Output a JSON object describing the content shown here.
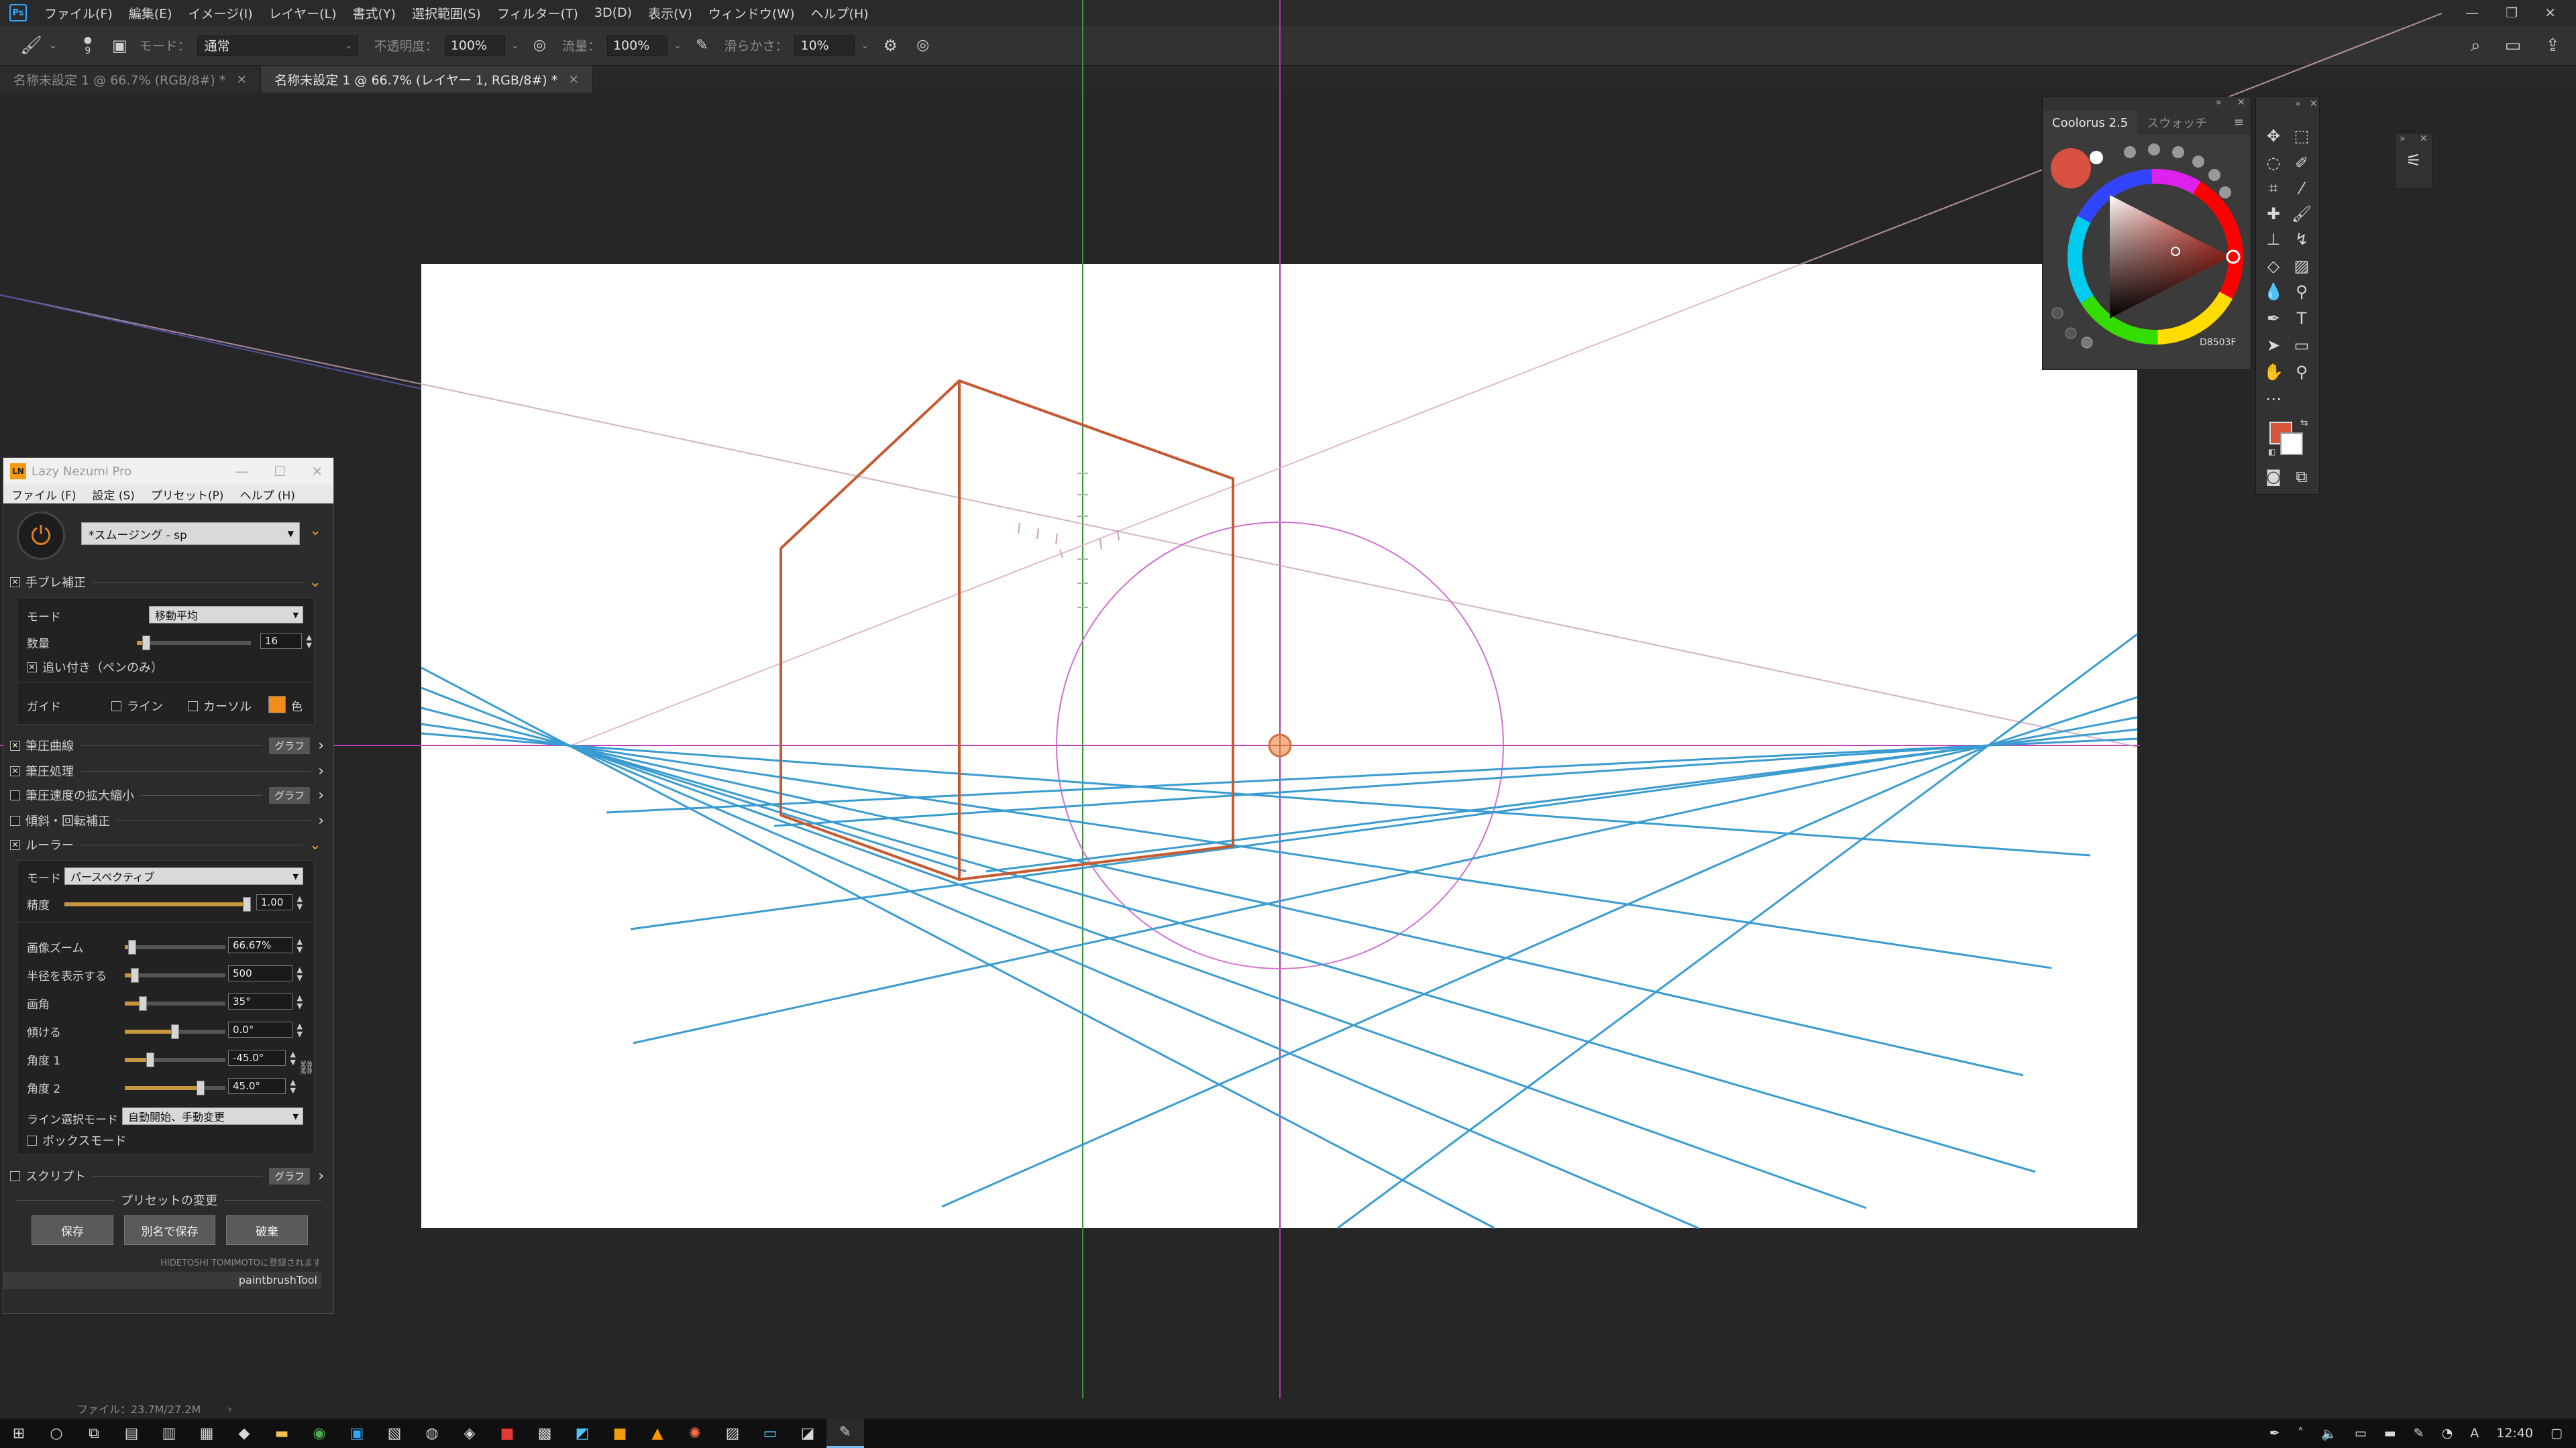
{
  "menubar": {
    "app_icon": "Ps",
    "items": [
      "ファイル(F)",
      "編集(E)",
      "イメージ(I)",
      "レイヤー(L)",
      "書式(Y)",
      "選択範囲(S)",
      "フィルター(T)",
      "3D(D)",
      "表示(V)",
      "ウィンドウ(W)",
      "ヘルプ(H)"
    ]
  },
  "options_bar": {
    "mode_label": "モード：",
    "mode_value": "通常",
    "opacity_label": "不透明度：",
    "opacity_value": "100%",
    "flow_label": "流量：",
    "flow_value": "100%",
    "smoothing_label": "滑らかさ：",
    "smoothing_value": "10%",
    "brush_size": "9"
  },
  "tabs": [
    {
      "label": "名称未設定 1 @ 66.7% (RGB/8#) *",
      "active": false
    },
    {
      "label": "名称未設定 1 @ 66.7% (レイヤー 1, RGB/8#) *",
      "active": true
    }
  ],
  "status": {
    "text": "ファイル：23.7M/27.2M"
  },
  "taskbar": {
    "time": "12:40"
  },
  "lazy_nezumi": {
    "title": "Lazy Nezumi Pro",
    "icon_text": "LN",
    "menu": [
      "ファイル (F)",
      "設定 (S)",
      "プリセット(P)",
      "ヘルプ (H)"
    ],
    "preset": "*スムージング - sp",
    "stabilizer": {
      "label": "手ブレ補正",
      "mode_label": "モード",
      "mode_value": "移動平均",
      "amount_label": "数量",
      "amount_value": "16",
      "amount_fraction": 0.08,
      "pen_only_label": "追い付き（ペンのみ）",
      "guide_label": "ガイド",
      "line_label": "ライン",
      "cursor_label": "カーソル",
      "color_label": "色",
      "guide_color": "#f28c1c"
    },
    "sections": {
      "pressure_curve": "筆圧曲線",
      "pressure_process": "筆圧処理",
      "pressure_scale": "筆圧速度の拡大縮小",
      "tilt": "傾斜・回転補正",
      "ruler": "ルーラー",
      "graph": "グラフ"
    },
    "ruler": {
      "mode_label": "モード",
      "mode_value": "パースペクティブ",
      "precision_label": "精度",
      "precision_value": "1.00",
      "precision_fraction": 1.0,
      "zoom_label": "画像ズーム",
      "zoom_value": "66.67%",
      "zoom_fraction": 0.07,
      "radius_label": "半径を表示する",
      "radius_value": "500",
      "radius_fraction": 0.1,
      "fov_label": "画角",
      "fov_value": "35°",
      "fov_fraction": 0.18,
      "tilt_label": "傾ける",
      "tilt_value": "0.0°",
      "tilt_fraction": 0.5,
      "angle1_label": "角度 1",
      "angle1_value": "-45.0°",
      "angle1_fraction": 0.25,
      "angle2_label": "角度 2",
      "angle2_value": "45.0°",
      "angle2_fraction": 0.75,
      "line_select_label": "ライン選択モード",
      "line_select_value": "自動開始、手動変更",
      "box_mode_label": "ボックスモード"
    },
    "script_label": "スクリプト",
    "preset_change_label": "プリセットの変更",
    "buttons": {
      "save": "保存",
      "save_as": "別名で保存",
      "discard": "破棄"
    },
    "footer": "HIDETOSHI TOMIMOTOに登録されます",
    "tool_name": "paintbrushTool"
  },
  "coolorus": {
    "tab_active": "Coolorus 2.5",
    "tab_inactive": "スウォッチ",
    "hex": "D8503F",
    "current_color": "#d8503f"
  },
  "colors": {
    "foreground": "#d4553a",
    "background": "#ffffff",
    "perspective_lines": "#3a9bd0",
    "box_lines": "#c45a32",
    "horizon": "#c040c0"
  }
}
